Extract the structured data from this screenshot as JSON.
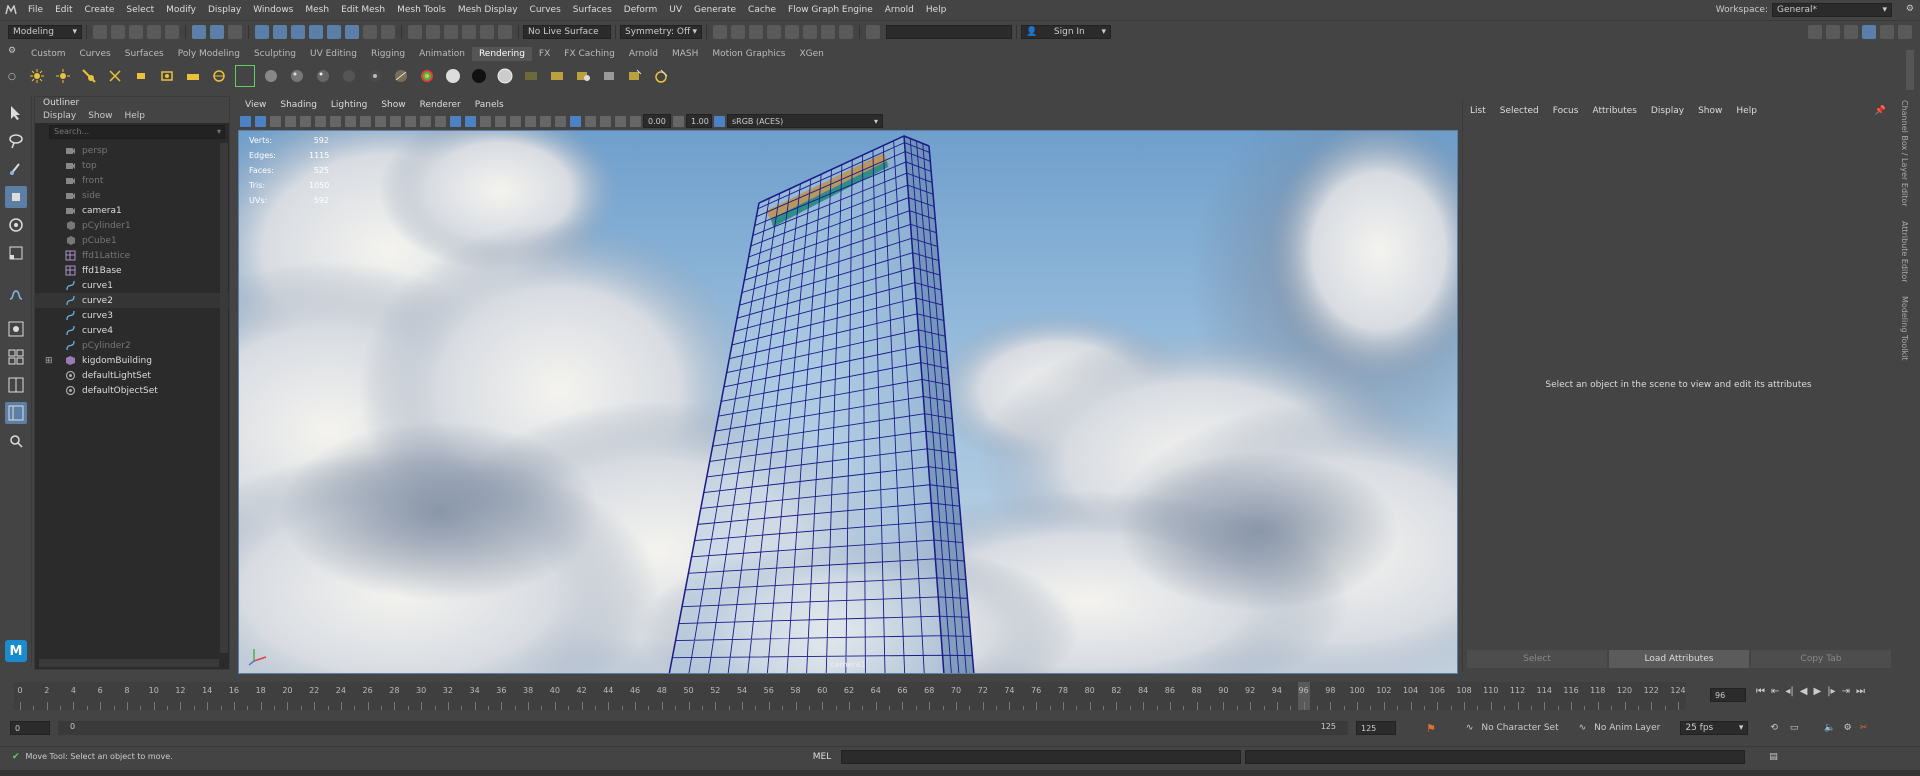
{
  "menubar": {
    "items": [
      "File",
      "Edit",
      "Create",
      "Select",
      "Modify",
      "Display",
      "Windows",
      "Mesh",
      "Edit Mesh",
      "Mesh Tools",
      "Mesh Display",
      "Curves",
      "Surfaces",
      "Deform",
      "UV",
      "Generate",
      "Cache",
      "Flow Graph Engine",
      "Arnold",
      "Help"
    ],
    "workspace_label": "Workspace:",
    "workspace_value": "General*"
  },
  "statusline": {
    "mode": "Modeling",
    "live_surface": "No Live Surface",
    "symmetry": "Symmetry: Off",
    "sign_in": "Sign In"
  },
  "shelf": {
    "tabs": [
      "Custom",
      "Curves",
      "Surfaces",
      "Poly Modeling",
      "Sculpting",
      "UV Editing",
      "Rigging",
      "Animation",
      "Rendering",
      "FX",
      "FX Caching",
      "Arnold",
      "MASH",
      "Motion Graphics",
      "XGen"
    ],
    "active_tab": "Rendering"
  },
  "outliner": {
    "title": "Outliner",
    "menus": [
      "Display",
      "Show",
      "Help"
    ],
    "search_placeholder": "Search...",
    "items": [
      {
        "label": "persp",
        "dim": true,
        "icon": "camera"
      },
      {
        "label": "top",
        "dim": true,
        "icon": "camera"
      },
      {
        "label": "front",
        "dim": true,
        "icon": "camera"
      },
      {
        "label": "side",
        "dim": true,
        "icon": "camera"
      },
      {
        "label": "camera1",
        "dim": false,
        "icon": "camera"
      },
      {
        "label": "pCylinder1",
        "dim": true,
        "icon": "mesh"
      },
      {
        "label": "pCube1",
        "dim": true,
        "icon": "mesh"
      },
      {
        "label": "ffd1Lattice",
        "dim": true,
        "icon": "lattice"
      },
      {
        "label": "ffd1Base",
        "dim": false,
        "icon": "lattice"
      },
      {
        "label": "curve1",
        "dim": false,
        "icon": "curve"
      },
      {
        "label": "curve2",
        "dim": false,
        "icon": "curve",
        "selected": true
      },
      {
        "label": "curve3",
        "dim": false,
        "icon": "curve"
      },
      {
        "label": "curve4",
        "dim": false,
        "icon": "curve"
      },
      {
        "label": "pCylinder2",
        "dim": true,
        "icon": "curve"
      },
      {
        "label": "kigdomBuilding",
        "dim": false,
        "icon": "group",
        "expandable": true
      },
      {
        "label": "defaultLightSet",
        "dim": false,
        "icon": "set"
      },
      {
        "label": "defaultObjectSet",
        "dim": false,
        "icon": "set"
      }
    ]
  },
  "viewport": {
    "menus": [
      "View",
      "Shading",
      "Lighting",
      "Show",
      "Renderer",
      "Panels"
    ],
    "exposure": "0.00",
    "gamma": "1.00",
    "colorspace": "sRGB (ACES)",
    "hud": [
      {
        "label": "Verts:",
        "value": "592"
      },
      {
        "label": "Edges:",
        "value": "1115"
      },
      {
        "label": "Faces:",
        "value": "525"
      },
      {
        "label": "Tris:",
        "value": "1050"
      },
      {
        "label": "UVs:",
        "value": "592"
      }
    ],
    "camera_label": "camera1"
  },
  "attribute_editor": {
    "menus": [
      "List",
      "Selected",
      "Focus",
      "Attributes",
      "Display",
      "Show",
      "Help"
    ],
    "message": "Select an object in the scene to view and edit its attributes",
    "buttons": [
      "Select",
      "Load Attributes",
      "Copy Tab"
    ],
    "side_tabs": [
      "Channel Box / Layer Editor",
      "Attribute Editor",
      "Modeling Toolkit"
    ]
  },
  "timeline": {
    "start": 0,
    "end": 124,
    "step": 2,
    "current": 96,
    "current_field": "96",
    "labels": [
      "0",
      "2",
      "4",
      "6",
      "8",
      "10",
      "12",
      "14",
      "16",
      "18",
      "20",
      "22",
      "24",
      "26",
      "28",
      "30",
      "32",
      "34",
      "36",
      "38",
      "40",
      "42",
      "44",
      "46",
      "48",
      "50",
      "52",
      "54",
      "56",
      "58",
      "60",
      "62",
      "64",
      "66",
      "68",
      "70",
      "72",
      "74",
      "76",
      "78",
      "80",
      "82",
      "84",
      "86",
      "88",
      "90",
      "92",
      "94",
      "96",
      "98",
      "100",
      "102",
      "104",
      "106",
      "108",
      "110",
      "112",
      "114",
      "116",
      "118",
      "120",
      "122",
      "124"
    ]
  },
  "range": {
    "start_field": "0",
    "inner_start": "0",
    "inner_end": "125",
    "end_field": "125",
    "character_set": "No Character Set",
    "anim_layer": "No Anim Layer",
    "fps": "25 fps"
  },
  "cmdline": {
    "help_text": "Move Tool: Select an object to move.",
    "language": "MEL"
  },
  "colors": {
    "accent": "#5d7fa6",
    "wireframe": "#1a1a8a",
    "background": "#444444"
  }
}
